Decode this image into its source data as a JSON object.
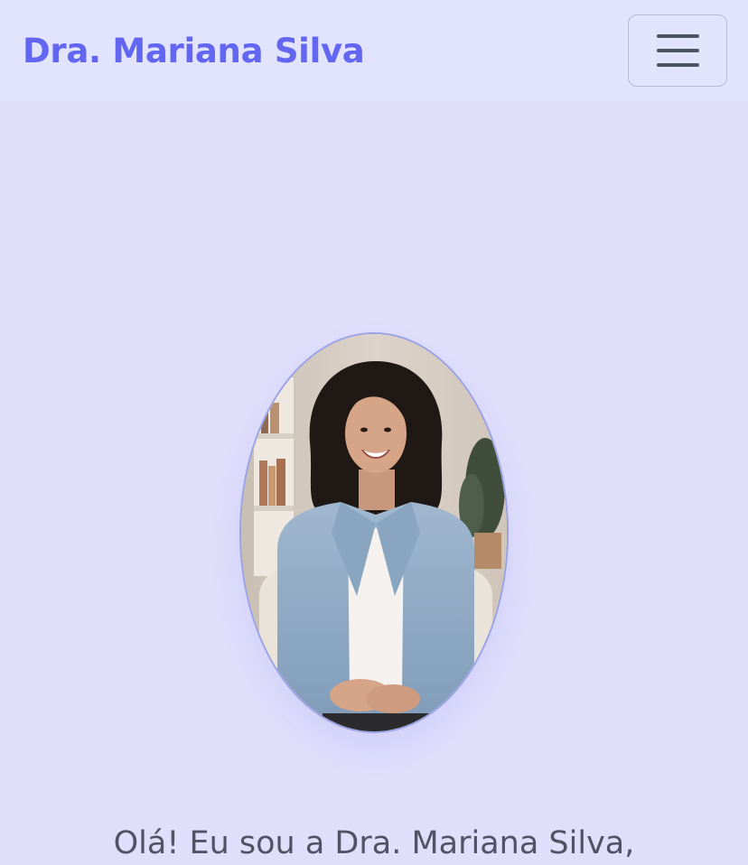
{
  "navbar": {
    "brand": "Dra. Mariana Silva",
    "menu_toggle_icon": "hamburger-menu-icon"
  },
  "hero": {
    "portrait_alt": "Dra. Mariana Silva",
    "intro_text": "Olá! Eu sou a Dra. Mariana Silva,"
  },
  "colors": {
    "accent": "#6366f1",
    "background": "#e0dffb",
    "navbar_bg": "#e2e3fc",
    "text": "#525266"
  }
}
